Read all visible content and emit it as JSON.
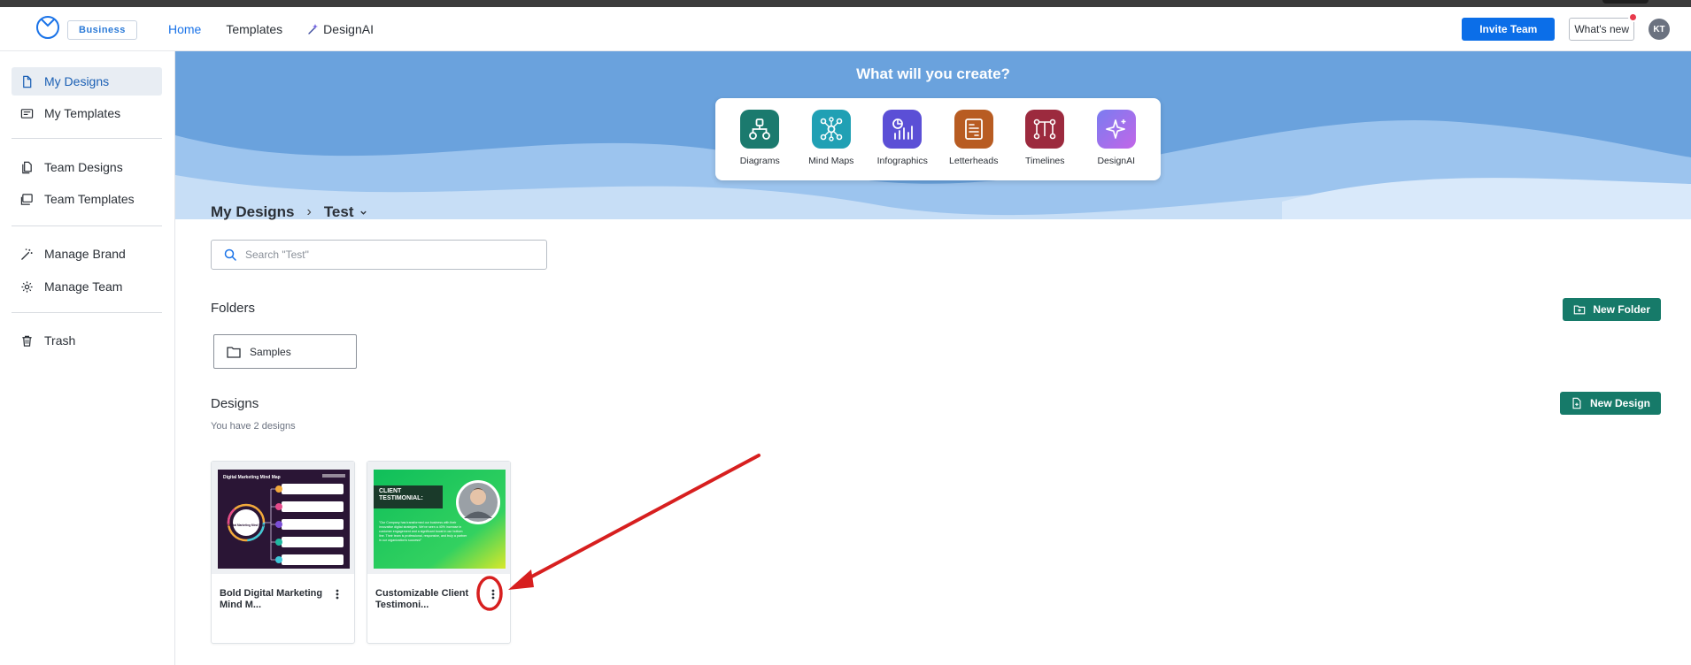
{
  "header": {
    "badge": "Business",
    "nav": [
      {
        "label": "Home"
      },
      {
        "label": "Templates"
      },
      {
        "label": "DesignAI"
      }
    ],
    "invite_label": "Invite Team",
    "whats_new_label": "What's new",
    "avatar_initials": "KT"
  },
  "sidebar": {
    "items": [
      {
        "label": "My Designs",
        "icon": "file-icon"
      },
      {
        "label": "My Templates",
        "icon": "template-icon"
      },
      {
        "label": "Team Designs",
        "icon": "team-file-icon"
      },
      {
        "label": "Team Templates",
        "icon": "team-template-icon"
      },
      {
        "label": "Manage Brand",
        "icon": "magic-wand-icon"
      },
      {
        "label": "Manage Team",
        "icon": "gear-icon"
      },
      {
        "label": "Trash",
        "icon": "trash-icon"
      }
    ]
  },
  "banner": {
    "title": "What will you create?",
    "tiles": [
      {
        "label": "Diagrams",
        "color": "#1b7a6e"
      },
      {
        "label": "Mind Maps",
        "color": "#20a0b4"
      },
      {
        "label": "Infographics",
        "color": "#5b4fd6"
      },
      {
        "label": "Letterheads",
        "color": "#b85c22"
      },
      {
        "label": "Timelines",
        "color": "#9c2a3e"
      },
      {
        "label": "DesignAI",
        "color": "#9a6bf0"
      }
    ]
  },
  "breadcrumb": {
    "root": "My Designs",
    "current": "Test"
  },
  "search": {
    "placeholder": "Search \"Test\""
  },
  "folders": {
    "title": "Folders",
    "new_label": "New Folder",
    "items": [
      {
        "name": "Samples"
      }
    ]
  },
  "designs": {
    "title": "Designs",
    "count_text": "You have 2 designs",
    "new_label": "New Design",
    "items": [
      {
        "name": "Bold Digital Marketing Mind M...",
        "thumb": {
          "title": "Digital Marketing Mind Map",
          "center": "Digital Marketing Mind Map",
          "bg": "#2a1535"
        }
      },
      {
        "name": "Customizable Client Testimoni...",
        "thumb": {
          "title": "CLIENT TESTIMONIAL:",
          "body": "\"Our Company has transformed our business with their innovative digital strategies. We've seen a 40% increase in customer engagement and a significant boost in our bottom line. Their team is professional, responsive, and truly a partner in our organization's success!\"",
          "bg": "#1fc46a"
        }
      }
    ]
  },
  "colors": {
    "accent_blue": "#0b6ee8",
    "green": "#167a69",
    "annotation_red": "#d71f1f"
  }
}
